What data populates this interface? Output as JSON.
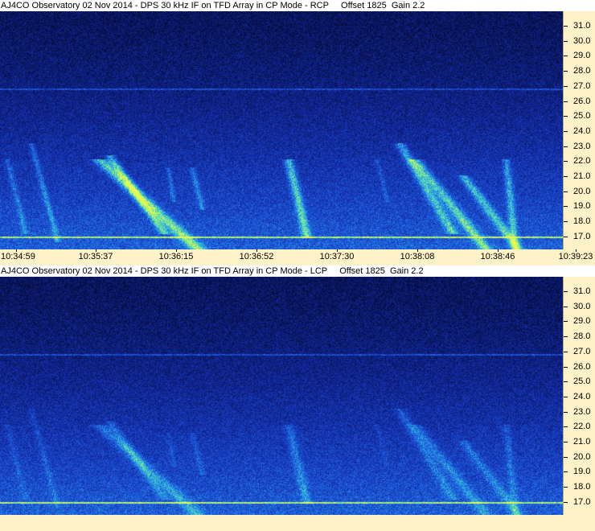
{
  "colors": {
    "axis_background": "#fff2c8",
    "spectrogram_dark": "#0a1a4a",
    "spectrogram_bright": "#c8f060"
  },
  "panels": [
    {
      "id": "rcp",
      "title": "AJ4CO Observatory 02 Nov 2014 - DPS 30 kHz IF on TFD Array in CP Mode - RCP     Offset 1825  Gain 2.2",
      "freq_labels": [
        "31.0",
        "30.0",
        "29.0",
        "28.0",
        "27.0",
        "26.0",
        "25.0",
        "24.0",
        "23.0",
        "22.0",
        "21.0",
        "20.0",
        "19.0",
        "18.0",
        "17.0"
      ],
      "time_labels": [
        "10:34:59",
        "10:35:37",
        "10:36:15",
        "10:36:52",
        "10:37:30",
        "10:38:08",
        "10:38:46",
        "10:39:23"
      ]
    },
    {
      "id": "lcp",
      "title": "AJ4CO Observatory 02 Nov 2014 - DPS 30 kHz IF on TFD Array in CP Mode - LCP     Offset 1825  Gain 2.2",
      "freq_labels": [
        "31.0",
        "30.0",
        "29.0",
        "28.0",
        "27.0",
        "26.0",
        "25.0",
        "24.0",
        "23.0",
        "22.0",
        "21.0",
        "20.0",
        "19.0",
        "18.0",
        "17.0"
      ],
      "time_labels": []
    }
  ]
}
